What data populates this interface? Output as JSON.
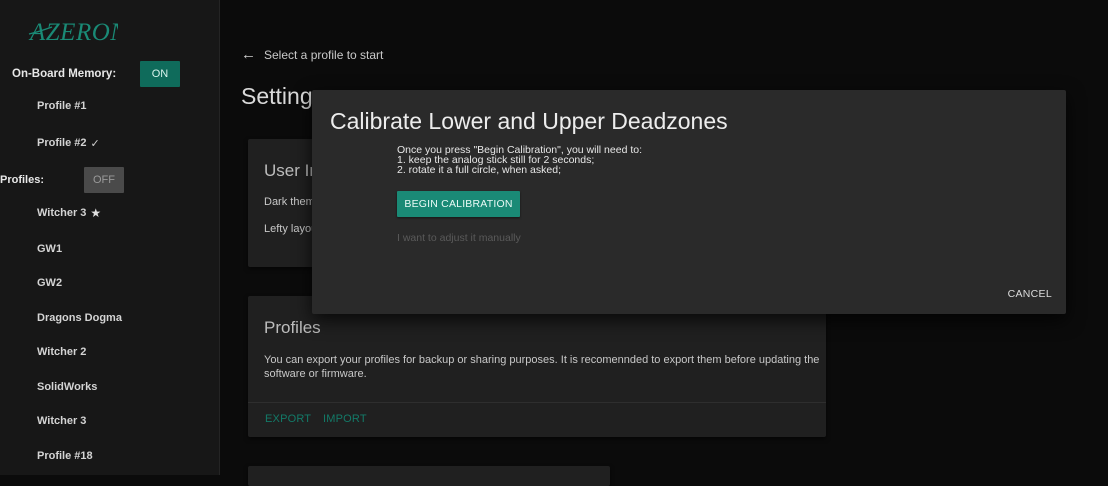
{
  "app": {
    "logo_text": "AZERON"
  },
  "sidebar": {
    "onboard_label": "On-Board Memory:",
    "onboard_toggle": "ON",
    "profiles_label": "Profiles:",
    "profiles_toggle": "OFF",
    "items": [
      {
        "label": "Profile #1",
        "mark": ""
      },
      {
        "label": "Profile #2",
        "mark": "✓"
      },
      {
        "label": "Witcher 3",
        "mark": "★"
      },
      {
        "label": "GW1",
        "mark": ""
      },
      {
        "label": "GW2",
        "mark": ""
      },
      {
        "label": "Dragons Dogma",
        "mark": ""
      },
      {
        "label": "Witcher 2",
        "mark": ""
      },
      {
        "label": "SolidWorks",
        "mark": ""
      },
      {
        "label": "Witcher 3",
        "mark": ""
      },
      {
        "label": "Profile #18",
        "mark": ""
      }
    ]
  },
  "main": {
    "back_text": "Select a profile to start",
    "page_title": "Settings",
    "user_interface_card": {
      "title": "User Interface",
      "rows": [
        "Dark theme",
        "Lefty layout"
      ]
    },
    "profiles_card": {
      "title": "Profiles",
      "description": "You can export your profiles for backup or sharing purposes. It is recomennded to export them before updating the software or firmware.",
      "export_label": "EXPORT",
      "import_label": "IMPORT"
    }
  },
  "dialog": {
    "title": "Calibrate Lower and Upper Deadzones",
    "body_lines": [
      "Once you press \"Begin Calibration\", you will need to:",
      "1. keep the analog stick still for 2 seconds;",
      "2. rotate it a full circle, when asked;"
    ],
    "begin_button": "BEGIN CALIBRATION",
    "manual_link": "I want to adjust it manually",
    "cancel_button": "CANCEL"
  },
  "colors": {
    "accent": "#1a8a76",
    "toggle_on": "#0f6b5b",
    "toggle_off": "#4a4a4a",
    "background": "#0b0b0b",
    "sidebar": "#171717",
    "dialog": "#2a2a2a",
    "card": "#202020"
  },
  "icons": {
    "back": "arrow-left-icon",
    "selected": "check-icon",
    "favorite": "star-icon"
  }
}
